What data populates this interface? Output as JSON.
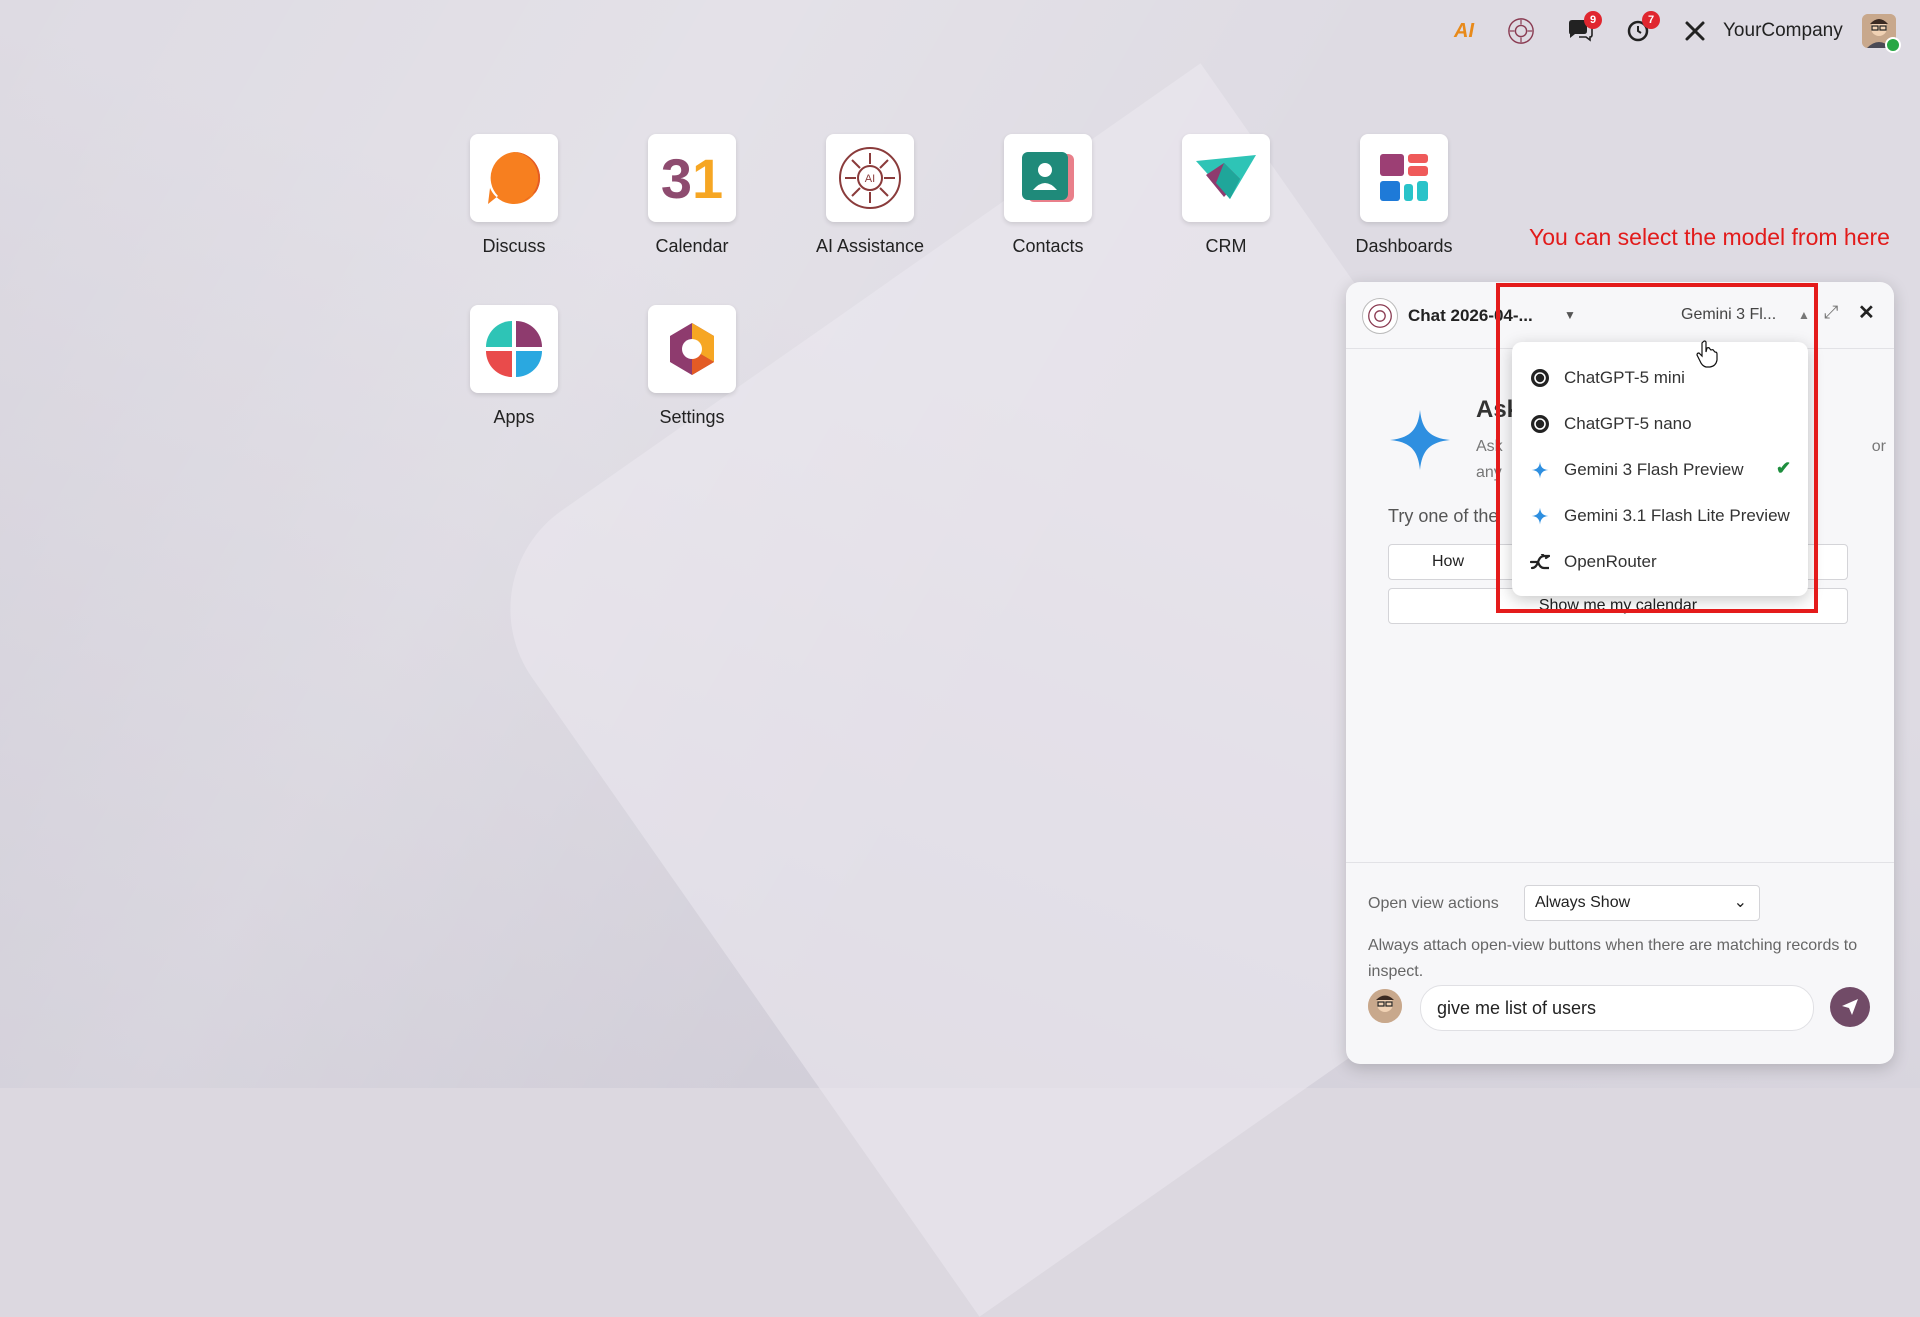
{
  "topbar": {
    "ai_label": "AI",
    "discuss_badge": "9",
    "activity_badge": "7",
    "company": "YourCompany"
  },
  "apps": [
    {
      "label": "Discuss",
      "icon": "discuss-icon"
    },
    {
      "label": "Calendar",
      "icon": "calendar-icon",
      "glyph": "31"
    },
    {
      "label": "AI Assistance",
      "icon": "ai-assistance-icon"
    },
    {
      "label": "Contacts",
      "icon": "contacts-icon"
    },
    {
      "label": "CRM",
      "icon": "crm-icon"
    },
    {
      "label": "Dashboards",
      "icon": "dashboards-icon"
    },
    {
      "label": "Apps",
      "icon": "apps-icon"
    },
    {
      "label": "Settings",
      "icon": "settings-icon"
    }
  ],
  "annotation": "You can select the model from here",
  "chat": {
    "title": "Chat 2026-04-...",
    "model": "Gemini 3 Fl...",
    "welcome_title": "Ask",
    "welcome_desc_1": "Ask",
    "welcome_desc_2": "any",
    "welcome_desc_tail": "or",
    "try_text": "Try one of the",
    "suggestions": [
      "How",
      "Show me my calendar"
    ],
    "open_view_actions_label": "Open view actions",
    "open_view_actions_value": "Always Show",
    "open_view_actions_help": "Always attach open-view buttons when there are matching records to inspect.",
    "message": "give me list of users"
  },
  "model_menu": {
    "items": [
      {
        "label": "ChatGPT-5 mini",
        "icon": "openai-icon",
        "selected": false
      },
      {
        "label": "ChatGPT-5 nano",
        "icon": "openai-icon",
        "selected": false
      },
      {
        "label": "Gemini 3 Flash Preview",
        "icon": "gemini-icon",
        "selected": true
      },
      {
        "label": "Gemini 3.1 Flash Lite Preview",
        "icon": "gemini-icon",
        "selected": false
      },
      {
        "label": "OpenRouter",
        "icon": "openrouter-icon",
        "selected": false
      }
    ]
  },
  "colors": {
    "accent": "#714b67",
    "annotation": "#e41b1b",
    "check": "#1e8e3e",
    "badge": "#e0262f"
  }
}
